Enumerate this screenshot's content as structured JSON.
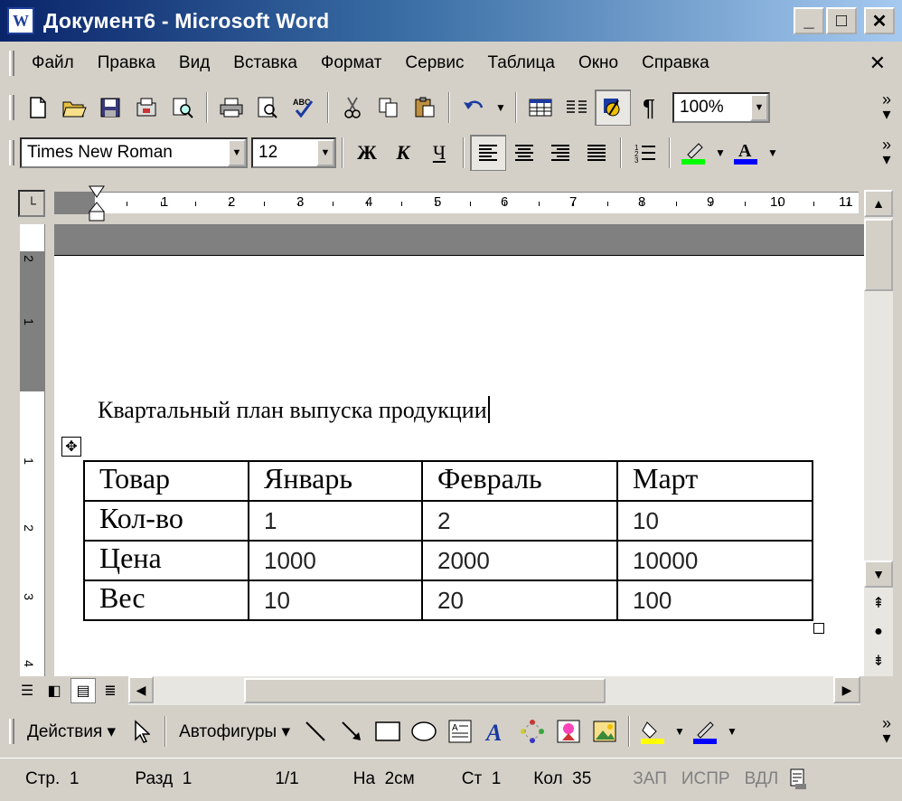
{
  "window": {
    "app_icon": "word-doc-icon",
    "title": "Документ6 - Microsoft Word",
    "minimize_glyph": "_",
    "maximize_glyph": "□",
    "close_glyph": "✕"
  },
  "menu": {
    "items": [
      "Файл",
      "Правка",
      "Вид",
      "Вставка",
      "Формат",
      "Сервис",
      "Таблица",
      "Окно",
      "Справка"
    ],
    "close_glyph": "✕"
  },
  "standard_toolbar": {
    "zoom": "100%"
  },
  "formatting_toolbar": {
    "font": "Times New Roman",
    "size": "12",
    "bold": "Ж",
    "italic": "К",
    "underline": "Ч",
    "highlight_color": "#00ff00",
    "font_color": "#0000ff"
  },
  "ruler": {
    "numbers": [
      "1",
      "2",
      "3",
      "4",
      "5",
      "6",
      "7",
      "8",
      "9",
      "10",
      "11"
    ],
    "vertical_numbers": [
      "2",
      "1",
      "1",
      "2",
      "3",
      "4"
    ]
  },
  "document": {
    "heading": "Квартальный план выпуска продукции",
    "table": {
      "header": [
        "Товар",
        "Январь",
        "Февраль",
        "Март"
      ],
      "rows": [
        [
          "Кол-во",
          "1",
          "2",
          "10"
        ],
        [
          "Цена",
          "1000",
          "2000",
          "10000"
        ],
        [
          "Вес",
          "10",
          "20",
          "100"
        ]
      ]
    }
  },
  "drawing_toolbar": {
    "actions": "Действия",
    "autoshapes": "Автофигуры",
    "fill_color": "#ffff00",
    "line_color": "#0000ff"
  },
  "status": {
    "page": "Стр.  1",
    "section": "Разд  1",
    "pages": "1/1",
    "at": "На  2см",
    "line": "Ст  1",
    "column": "Кол  35",
    "rec": "ЗАП",
    "trk": "ИСПР",
    "ext": "ВДЛ"
  }
}
